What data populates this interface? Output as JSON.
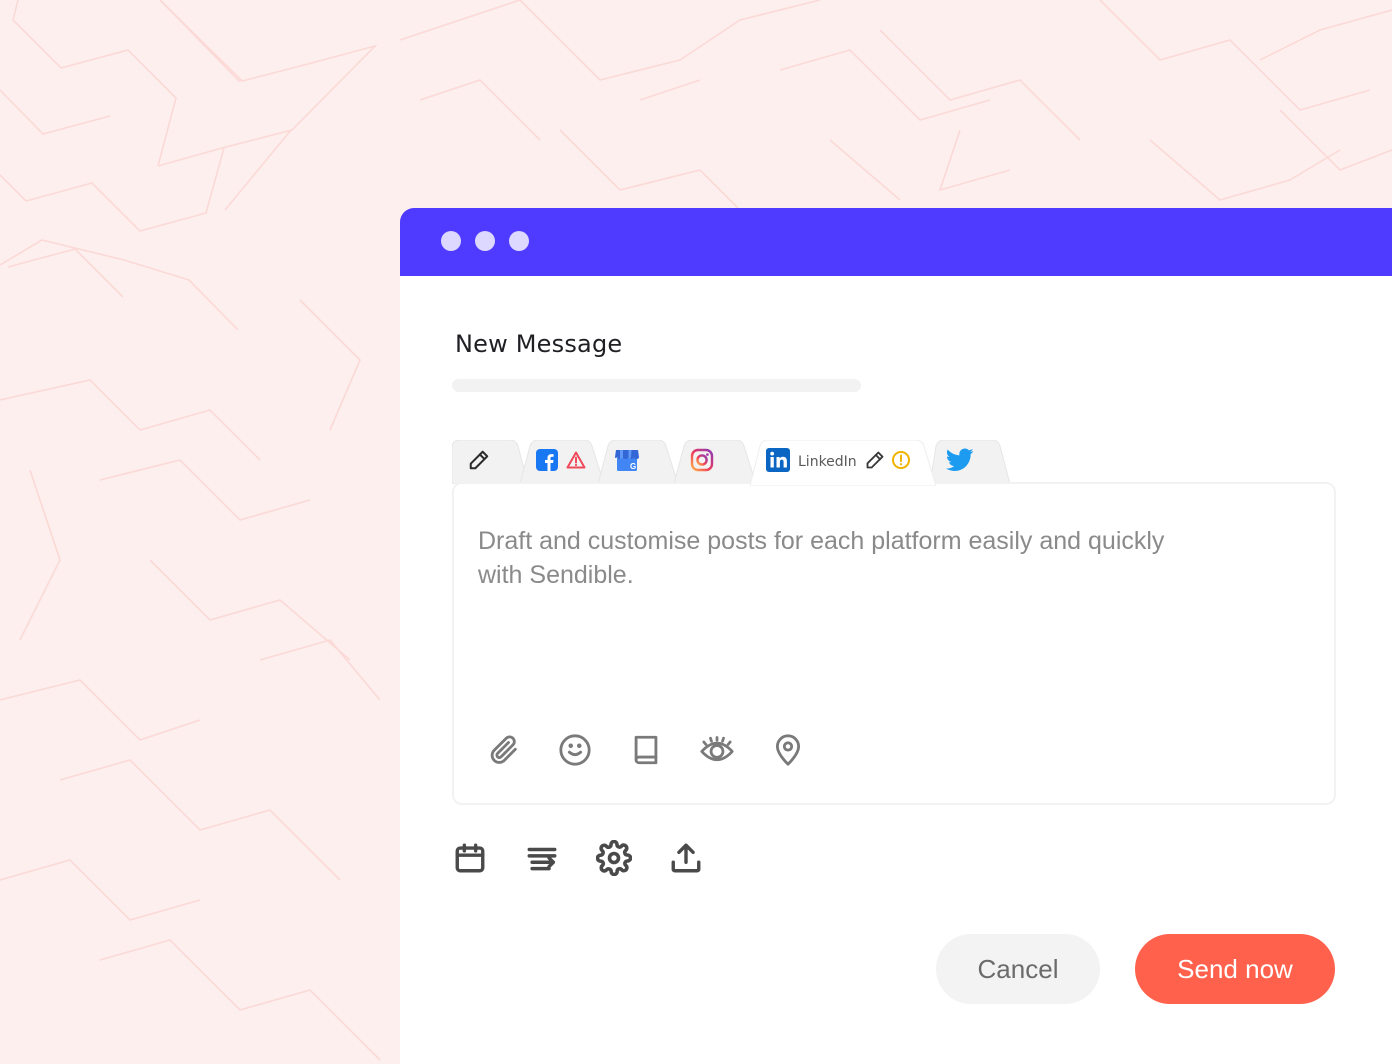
{
  "window": {
    "controls": [
      "dot",
      "dot",
      "dot"
    ],
    "accent_color": "#4f3aff"
  },
  "compose": {
    "title": "New Message",
    "tabs": [
      {
        "id": "all",
        "icon": "pencil-icon",
        "label": "",
        "active": false
      },
      {
        "id": "facebook",
        "icon": "facebook-icon",
        "status_icon": "warning-triangle-icon",
        "label": "",
        "active": false
      },
      {
        "id": "google-business",
        "icon": "google-my-business-icon",
        "label": "",
        "active": false
      },
      {
        "id": "instagram",
        "icon": "instagram-icon",
        "label": "",
        "active": false
      },
      {
        "id": "linkedin",
        "icon": "linkedin-icon",
        "label": "LinkedIn",
        "edit_icon": "pencil-icon",
        "status_icon": "alert-circle-icon",
        "active": true
      },
      {
        "id": "twitter",
        "icon": "twitter-icon",
        "label": "",
        "active": false
      }
    ],
    "editor_placeholder": "Draft and customise posts for each platform easily and quickly with Sendible.",
    "editor_tools": [
      "paperclip-icon",
      "smiley-icon",
      "book-icon",
      "eye-icon",
      "location-pin-icon"
    ],
    "bottom_tools": [
      "calendar-icon",
      "queue-icon",
      "gear-icon",
      "upload-icon"
    ]
  },
  "actions": {
    "cancel_label": "Cancel",
    "send_label": "Send now",
    "send_color": "#ff614d"
  }
}
